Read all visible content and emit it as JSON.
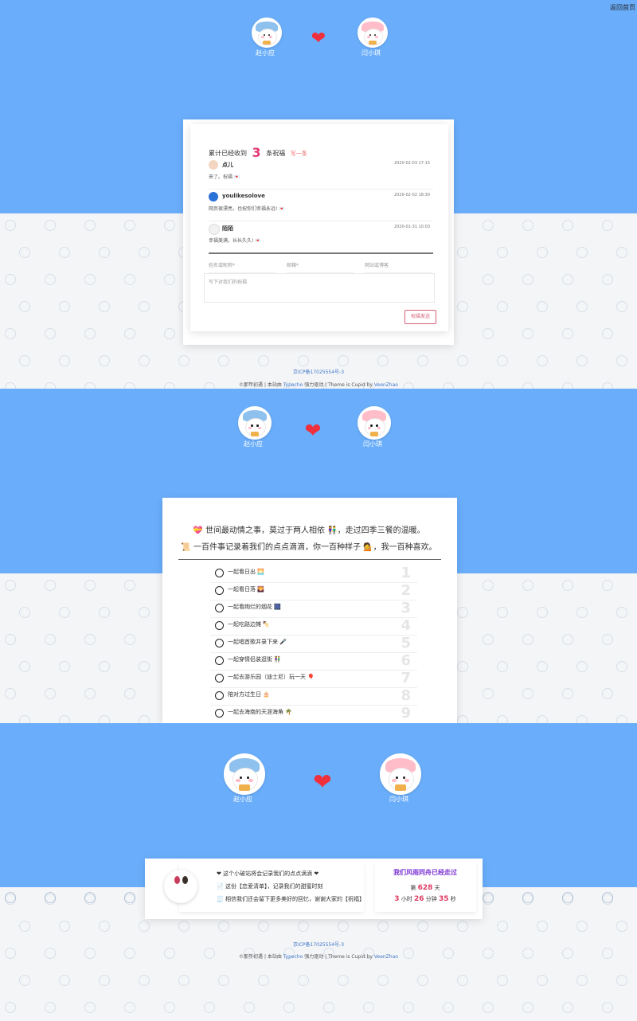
{
  "top": {
    "back_link": "返回首页",
    "couple": {
      "left_name": "赵小应",
      "right_name": "闫小琪",
      "heart": "❤"
    },
    "comments": {
      "title_prefix": "累计已经收到",
      "count": "3",
      "title_suffix": "条祝福",
      "next_label": "写一条",
      "items": [
        {
          "author": "点儿",
          "date": "2020-02-03 17:15",
          "text": "来了。祝福 💌"
        },
        {
          "author": "youlikesolove",
          "date": "2020-02-02 18:30",
          "text": "网页很漂亮，也祝你们幸福永远! 💌"
        },
        {
          "author": "陌陌",
          "date": "2020-01-31 10:03",
          "text": "幸福美满，长长久久! 💌"
        }
      ],
      "form": {
        "name_placeholder": "姓名或昵称*",
        "email_placeholder": "邮箱*",
        "site_placeholder": "网站或博客",
        "message_placeholder": "写下对我们的祝福",
        "submit": "祝福发送"
      }
    },
    "footer": {
      "icp": "京ICP备17025554号-3",
      "line": "©那年初遇 | 本站由 ",
      "typecho": "Typecho",
      "middle": " 强力驱动 | Theme is Cupid by ",
      "author": "VeenZhao"
    }
  },
  "middle": {
    "couple": {
      "left_name": "赵小应",
      "right_name": "闫小琪",
      "heart": "❤"
    },
    "quote_line1": "💝 世间最动情之事，莫过于两人相依 👫，走过四季三餐的温暖。",
    "quote_line2": "📜 一百件事记录着我们的点点滴滴，你一百种样子 💁，我一百种喜欢。",
    "list": [
      {
        "label": "一起看日出 🌅",
        "num": "1"
      },
      {
        "label": "一起看日落 🌄",
        "num": "2"
      },
      {
        "label": "一起看绚烂的烟花 🎆",
        "num": "3"
      },
      {
        "label": "一起吃路边摊 🍢",
        "num": "4"
      },
      {
        "label": "一起唱首歌并录下来 🎤",
        "num": "5"
      },
      {
        "label": "一起穿情侣装逛街 👫",
        "num": "6"
      },
      {
        "label": "一起去游乐园（迪士尼）玩一天 🎈",
        "num": "7"
      },
      {
        "label": "陪对方过生日 🎂",
        "num": "8"
      },
      {
        "label": "一起去海南的天涯海角 🌴",
        "num": "9"
      }
    ]
  },
  "bottom": {
    "couple": {
      "left_name": "赵小应",
      "right_name": "闫小琪",
      "heart": "❤"
    },
    "left_lines": [
      "❤ 这个小破站将会记录我们的点点滴滴 ❤",
      "📄 这份【恋爱清单】，记录我们的甜蜜时刻",
      "🧾 相信我们还会留下更多美好的回忆，谢谢大家的【祝福】"
    ],
    "right_title": "我们风雨同舟已经走过",
    "days_prefix": "第",
    "days": "628",
    "days_suffix": "天",
    "hours": "3",
    "hours_unit": "小时",
    "minutes": "26",
    "minutes_unit": "分钟",
    "seconds": "35",
    "seconds_unit": "秒",
    "footer": {
      "icp": "京ICP备17025554号-3",
      "line": "©那年初遇 | 本站由 ",
      "typecho": "Typecho",
      "middle": " 强力驱动 | Theme is Cupid by ",
      "author": "VeenZhao"
    }
  },
  "colors": {
    "blue": "#6aaefb",
    "heart": "#ef2f3c",
    "pink": "#d94f78",
    "purple": "#7b32d4"
  }
}
